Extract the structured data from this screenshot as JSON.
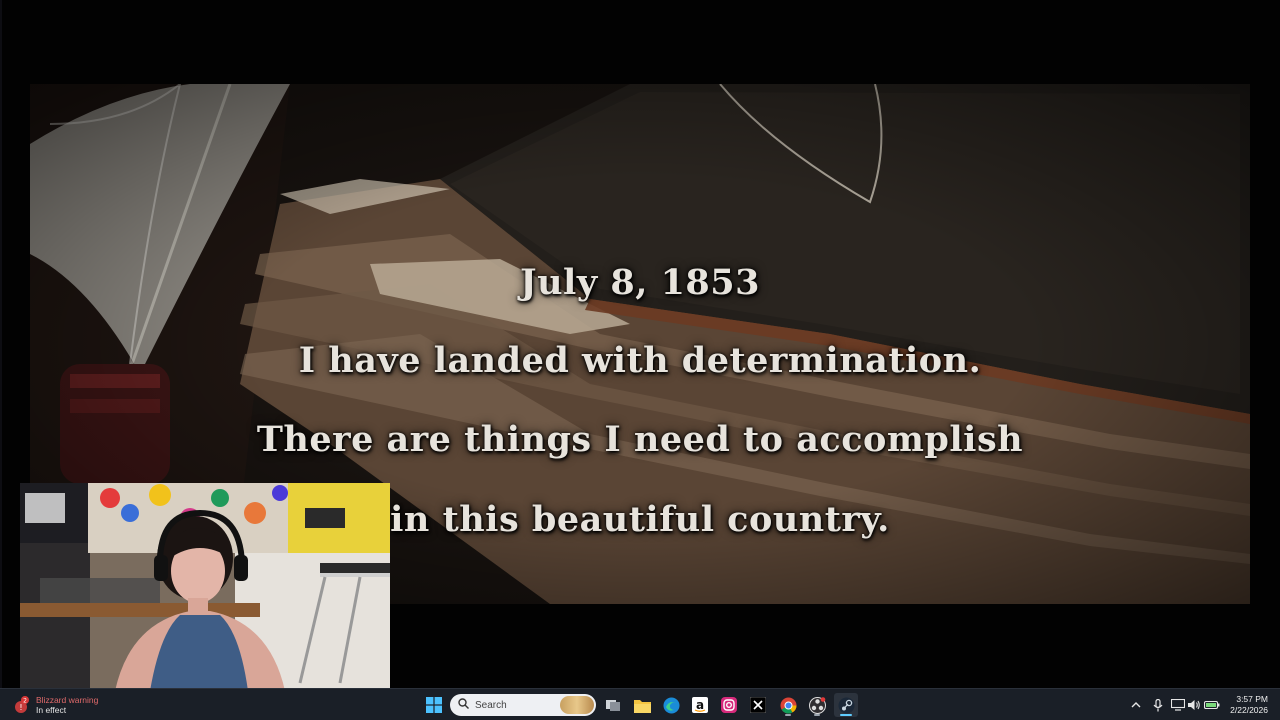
{
  "cutscene": {
    "date": "July 8, 1853",
    "line1": "I have landed with determination.",
    "line2": "There are things I need to accomplish",
    "line3": "in this beautiful country."
  },
  "taskbar": {
    "weather": {
      "badge": "2",
      "title": "Blizzard warning",
      "status": "In effect",
      "icon": "warning-weather-icon"
    },
    "search": {
      "placeholder": "Search"
    },
    "apps": [
      "windows-start-icon",
      "search-icon",
      "task-view-icon",
      "file-explorer-icon",
      "edge-icon",
      "amazon-icon",
      "instagram-icon",
      "x-icon",
      "chrome-icon",
      "obs-icon",
      "steam-icon"
    ],
    "tray": [
      "chevron-up-icon",
      "microphone-icon",
      "network-icon",
      "volume-icon",
      "battery-icon"
    ],
    "clock": {
      "time": "3:57 PM",
      "date": "2/22/2026"
    }
  },
  "colors": {
    "taskbar_bg": "#1a1f27",
    "accent": "#60cdff",
    "caption_text": "#e7e3dc",
    "warning_red": "#e06a6a"
  }
}
